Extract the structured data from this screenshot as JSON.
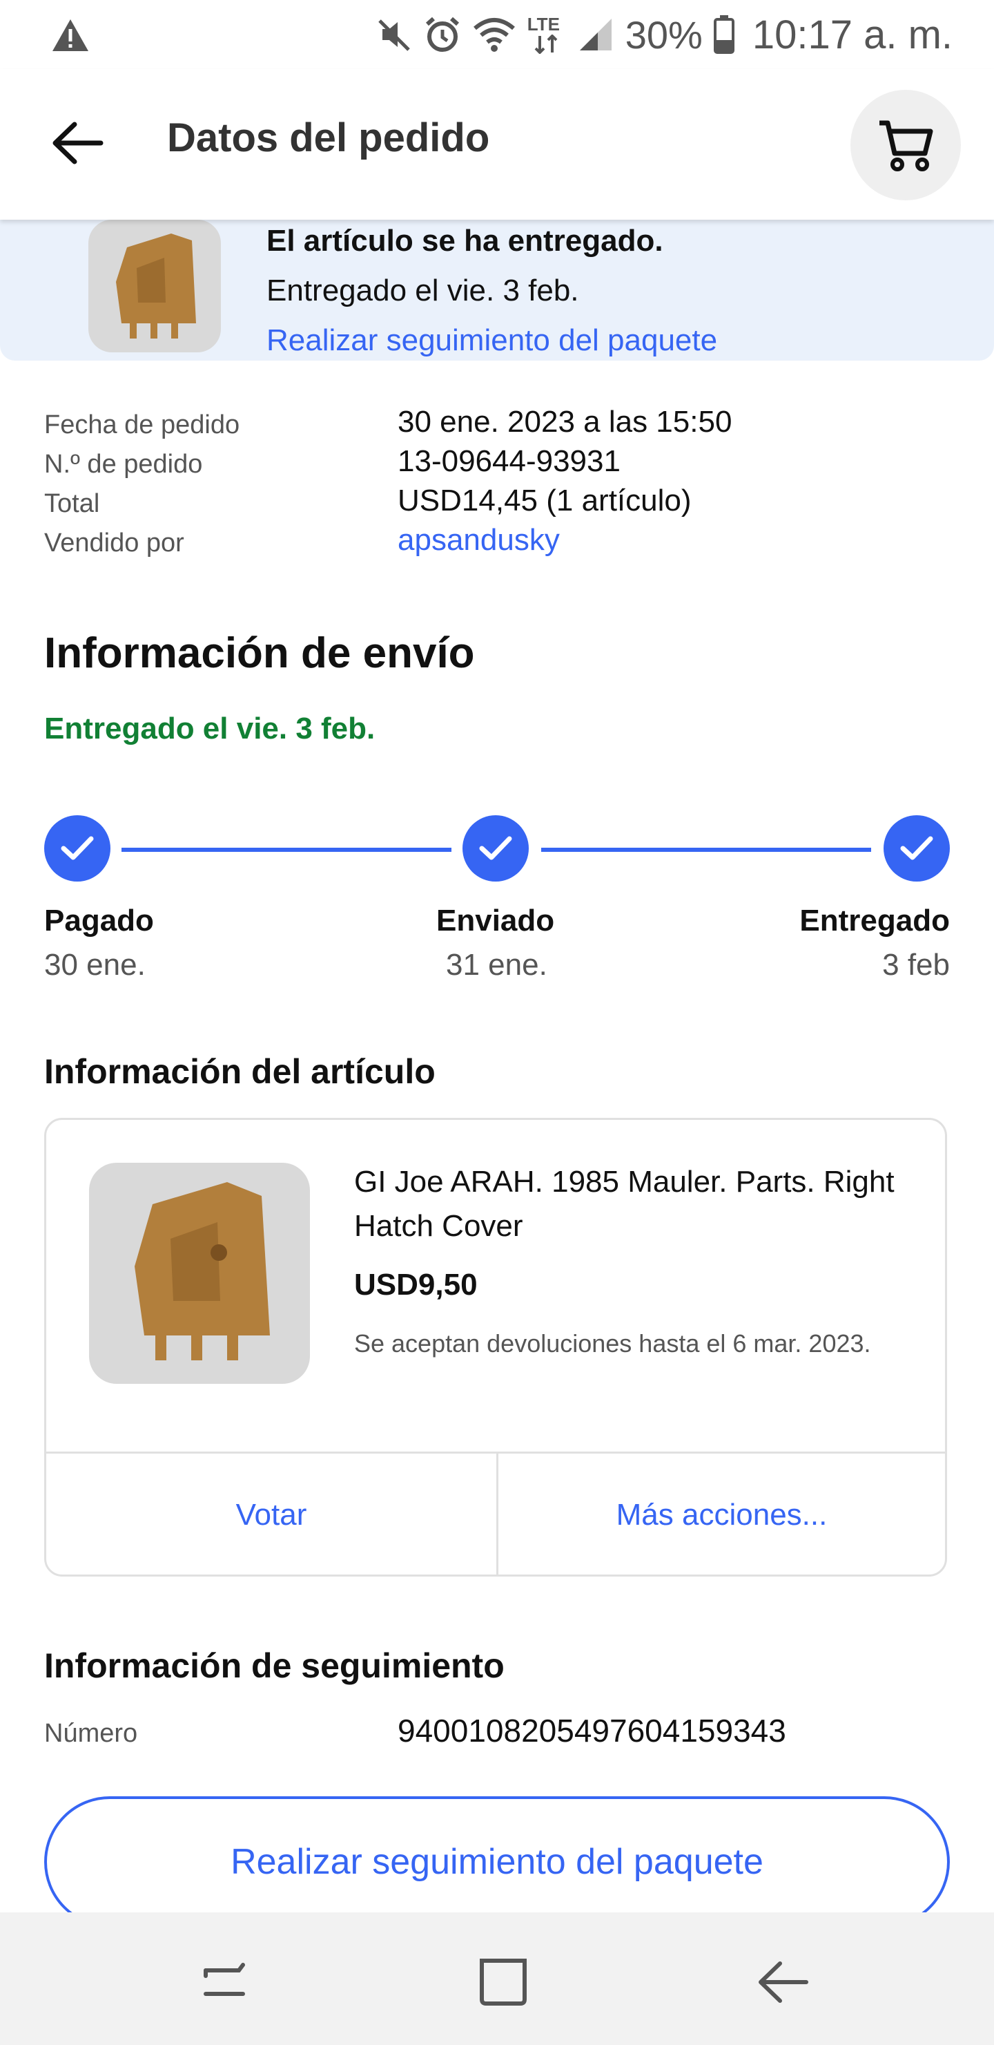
{
  "status_bar": {
    "battery_percent": "30%",
    "time": "10:17 a. m.",
    "network_label": "LTE",
    "icons": [
      "warning-icon",
      "mute-icon",
      "alarm-icon",
      "wifi-icon",
      "signal-icon",
      "battery-icon"
    ]
  },
  "app_bar": {
    "title": "Datos del pedido",
    "back_icon": "arrow-left-icon",
    "cart_icon": "cart-icon"
  },
  "banner": {
    "headline": "El artículo se ha entregado.",
    "delivered_on": "Entregado el vie. 3 feb.",
    "track_link": "Realizar seguimiento del paquete"
  },
  "order": {
    "rows": [
      {
        "label": "Fecha de pedido",
        "value": "30 ene. 2023 a las 15:50"
      },
      {
        "label": "N.º de pedido",
        "value": "13-09644-93931"
      },
      {
        "label": "Total",
        "value": "USD14,45 (1 artículo)"
      },
      {
        "label": "Vendido por",
        "value": "apsandusky"
      }
    ]
  },
  "shipping": {
    "heading": "Información de envío",
    "status": "Entregado el vie. 3 feb.",
    "steps": [
      {
        "label": "Pagado",
        "date": "30 ene."
      },
      {
        "label": "Enviado",
        "date": "31 ene."
      },
      {
        "label": "Entregado",
        "date": "3 feb"
      }
    ],
    "accent_color": "#3665f3",
    "status_color": "#118034"
  },
  "item": {
    "heading": "Información del artículo",
    "title": "GI Joe ARAH. 1985 Mauler. Parts. Right Hatch Cover",
    "price": "USD9,50",
    "returns": "Se aceptan devoluciones hasta el 6 mar. 2023.",
    "actions": [
      "Votar",
      "Más acciones..."
    ]
  },
  "tracking": {
    "heading": "Información de seguimiento",
    "number_label": "Número",
    "number_value": "9400108205497604159343",
    "button_label": "Realizar seguimiento del paquete"
  },
  "nav_bar": {
    "icons": [
      "recent-apps-icon",
      "home-icon",
      "back-icon"
    ]
  }
}
